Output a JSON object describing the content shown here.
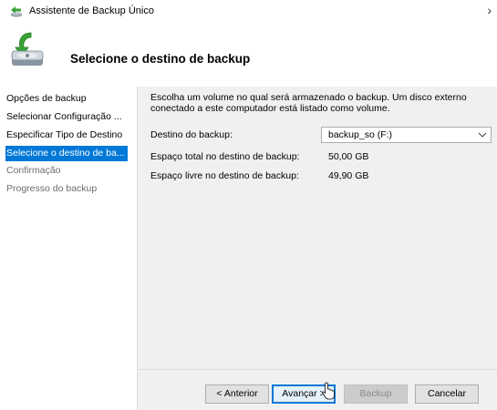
{
  "window": {
    "title": "Assistente de Backup Único",
    "heading": "Selecione o destino de backup"
  },
  "sidebar": {
    "items": [
      {
        "label": "Opções de backup",
        "state": "normal"
      },
      {
        "label": "Selecionar Configuração ...",
        "state": "normal"
      },
      {
        "label": "Especificar Tipo de Destino",
        "state": "normal"
      },
      {
        "label": "Selecione o destino de ba...",
        "state": "selected"
      },
      {
        "label": "Confirmação",
        "state": "disabled"
      },
      {
        "label": "Progresso do backup",
        "state": "disabled"
      }
    ]
  },
  "main": {
    "description": "Escolha um volume no qual será armazenado o backup. Um disco externo conectado a este computador está listado como volume.",
    "destination_label": "Destino do backup:",
    "destination_value": "backup_so (F:)",
    "total_label": "Espaço total no destino de backup:",
    "total_value": "50,00 GB",
    "free_label": "Espaço livre no destino de backup:",
    "free_value": "49,90 GB"
  },
  "buttons": {
    "previous": "< Anterior",
    "next": "Avançar >",
    "backup": "Backup",
    "cancel": "Cancelar"
  },
  "colors": {
    "selection": "#0078d7",
    "panel": "#f0f0f0"
  }
}
